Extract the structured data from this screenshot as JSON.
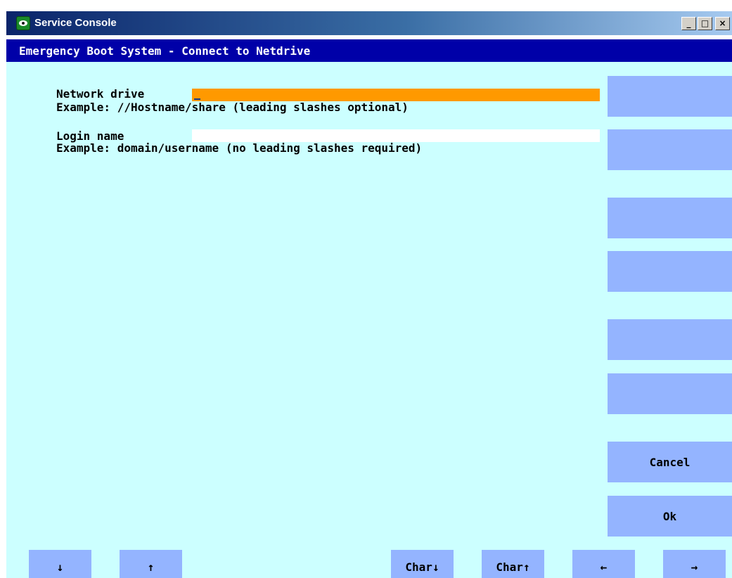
{
  "window": {
    "title": "Service Console",
    "min_glyph": "_",
    "max_glyph": "□",
    "close_glyph": "×"
  },
  "header": {
    "title": "Emergency Boot System - Connect to Netdrive"
  },
  "form": {
    "network_drive_label": "Network drive",
    "network_drive_value": "",
    "network_drive_example": "Example: //Hostname/share (leading slashes optional)",
    "login_name_label": "Login name",
    "login_name_value": "",
    "login_name_example": "Example: domain/username (no leading slashes required)"
  },
  "vertical_softkeys": [
    "",
    "",
    "",
    "",
    "",
    "",
    "Cancel",
    "Ok"
  ],
  "horizontal_softkeys": [
    "↓",
    "↑",
    "",
    "",
    "Char↓",
    "Char↑",
    "←",
    "→"
  ],
  "colors": {
    "background": "#ccffff",
    "header": "#0000a8",
    "active_field": "#ff9900",
    "softkey": "#94b4ff"
  }
}
